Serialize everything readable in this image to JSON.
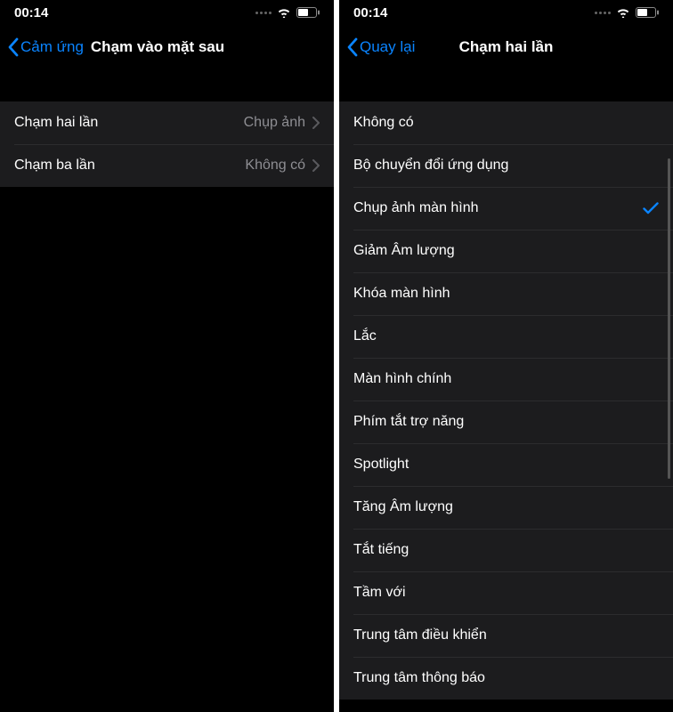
{
  "left": {
    "status": {
      "time": "00:14"
    },
    "nav": {
      "back": "Cảm ứng",
      "title": "Chạm vào mặt sau"
    },
    "rows": [
      {
        "label": "Chạm hai lần",
        "value": "Chụp ảnh"
      },
      {
        "label": "Chạm ba lần",
        "value": "Không có"
      }
    ]
  },
  "right": {
    "status": {
      "time": "00:14"
    },
    "nav": {
      "back": "Quay lại",
      "title": "Chạm hai lần"
    },
    "options": [
      {
        "label": "Không có",
        "selected": false
      },
      {
        "label": "Bộ chuyển đổi ứng dụng",
        "selected": false
      },
      {
        "label": "Chụp ảnh màn hình",
        "selected": true
      },
      {
        "label": "Giảm Âm lượng",
        "selected": false
      },
      {
        "label": "Khóa màn hình",
        "selected": false
      },
      {
        "label": "Lắc",
        "selected": false
      },
      {
        "label": "Màn hình chính",
        "selected": false
      },
      {
        "label": "Phím tắt trợ năng",
        "selected": false
      },
      {
        "label": "Spotlight",
        "selected": false
      },
      {
        "label": "Tăng Âm lượng",
        "selected": false
      },
      {
        "label": "Tắt tiếng",
        "selected": false
      },
      {
        "label": "Tầm với",
        "selected": false
      },
      {
        "label": "Trung tâm điều khiển",
        "selected": false
      },
      {
        "label": "Trung tâm thông báo",
        "selected": false
      }
    ]
  }
}
